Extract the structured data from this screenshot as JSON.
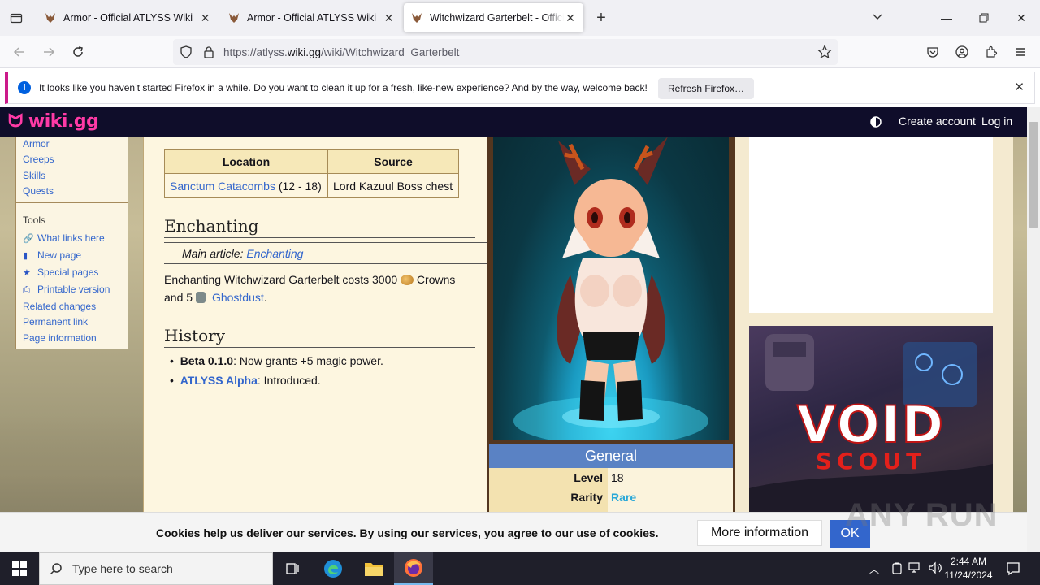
{
  "browser": {
    "tabs": [
      {
        "title": "Armor - Official ATLYSS Wiki",
        "active": false
      },
      {
        "title": "Armor - Official ATLYSS Wiki",
        "active": false
      },
      {
        "title": "Witchwizard Garterbelt - Official ATLYSS Wiki",
        "active": true
      }
    ],
    "url_prefix": "https://atlyss.",
    "url_domain": "wiki.gg",
    "url_suffix": "/wiki/Witchwizard_Garterbelt",
    "notification": {
      "message": "It looks like you haven’t started Firefox in a while. Do you want to clean it up for a fresh, like-new experience? And by the way, welcome back!",
      "button": "Refresh Firefox…"
    }
  },
  "wiki_header": {
    "logo": "wiki.gg",
    "create_account": "Create account",
    "log_in": "Log in"
  },
  "sidebar": {
    "nav_links": [
      "Armor",
      "Creeps",
      "Skills",
      "Quests"
    ],
    "tools_heading": "Tools",
    "tools": [
      {
        "label": "What links here",
        "icon": "link-icon"
      },
      {
        "label": "New page",
        "icon": "page-icon"
      },
      {
        "label": "Special pages",
        "icon": "star-icon"
      },
      {
        "label": "Printable version",
        "icon": "printer-icon"
      },
      {
        "label": "Related changes",
        "icon": ""
      },
      {
        "label": "Permanent link",
        "icon": ""
      },
      {
        "label": "Page information",
        "icon": ""
      }
    ]
  },
  "content": {
    "table": {
      "headers": [
        "Location",
        "Source"
      ],
      "rows": [
        {
          "location_link": "Sanctum Catacombs",
          "location_range": " (12 - 18)",
          "source": "Lord Kazuul Boss chest"
        }
      ]
    },
    "enchanting": {
      "heading": "Enchanting",
      "main_article_prefix": "Main article: ",
      "main_article_link": "Enchanting",
      "text1": "Enchanting Witchwizard Garterbelt costs 3000 ",
      "crowns": " Crowns",
      "text2": "and 5 ",
      "ghostdust": "Ghostdust",
      "period": "."
    },
    "history": {
      "heading": "History",
      "items": [
        {
          "bold": "Beta 0.1.0",
          "text": ": Now grants +5 magic power.",
          "link": false
        },
        {
          "bold": "ATLYSS Alpha",
          "text": ": Introduced.",
          "link": true
        }
      ]
    }
  },
  "infobox": {
    "section": "General",
    "rows": [
      {
        "key": "Level",
        "value": "18",
        "value_color": "#222222"
      },
      {
        "key": "Rarity",
        "value": "Rare",
        "value_color": "#2aa8d8"
      }
    ]
  },
  "ad": {
    "brand_line1": "VOID",
    "brand_line2": "SCOUT"
  },
  "cookie": {
    "text": "Cookies help us deliver our services. By using our services, you agree to our use of cookies.",
    "more": "More information",
    "ok": "OK"
  },
  "watermark": "ANY RUN",
  "taskbar": {
    "search_placeholder": "Type here to search",
    "time": "2:44 AM",
    "date": "11/24/2024"
  },
  "colors": {
    "accent": "#cc1a8a",
    "wiki_header": "#0f0d2a",
    "link": "#3366cc",
    "infobox_header": "#5a82c4"
  }
}
